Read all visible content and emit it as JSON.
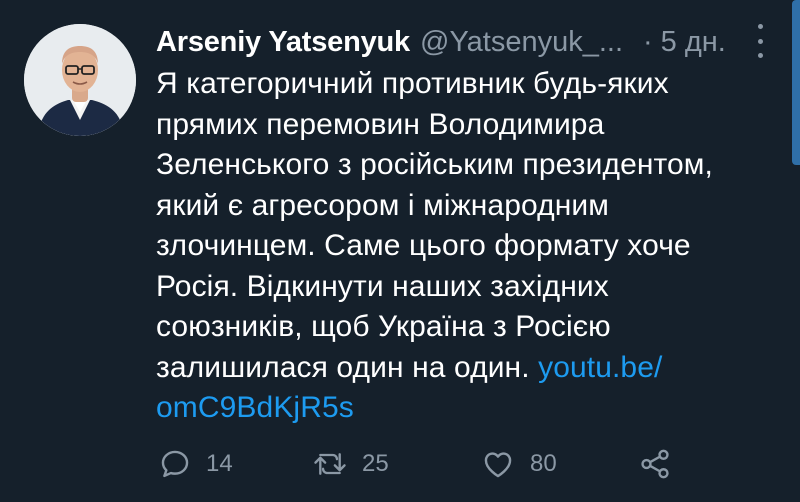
{
  "author": {
    "name": "Arseniy Yatsenyuk",
    "handle": "@Yatsenyuk_...",
    "time": "5 дн.",
    "separator": "·"
  },
  "tweet": {
    "lines": [
      "Я категоричний противник будь-яких",
      "прямих перемовин Володимира",
      "Зеленського з російським президентом,",
      "який є агресором і міжнародним",
      "злочинцем. Саме цього формату хоче",
      "Росія. Відкинути наших західних",
      "союзників, щоб Україна з Росією",
      "залишилася один на один. "
    ],
    "link_part1": "youtu.be/",
    "link_part2": "omC9BdKjR5s"
  },
  "actions": {
    "reply_count": "14",
    "retweet_count": "25",
    "like_count": "80"
  },
  "icons": {
    "reply": "reply-icon",
    "retweet": "retweet-icon",
    "like": "heart-icon",
    "share": "share-icon",
    "more": "more-vertical-icon"
  },
  "colors": {
    "background": "#15202b",
    "text": "#ffffff",
    "muted": "#8b98a5",
    "link": "#1d9bf0"
  }
}
